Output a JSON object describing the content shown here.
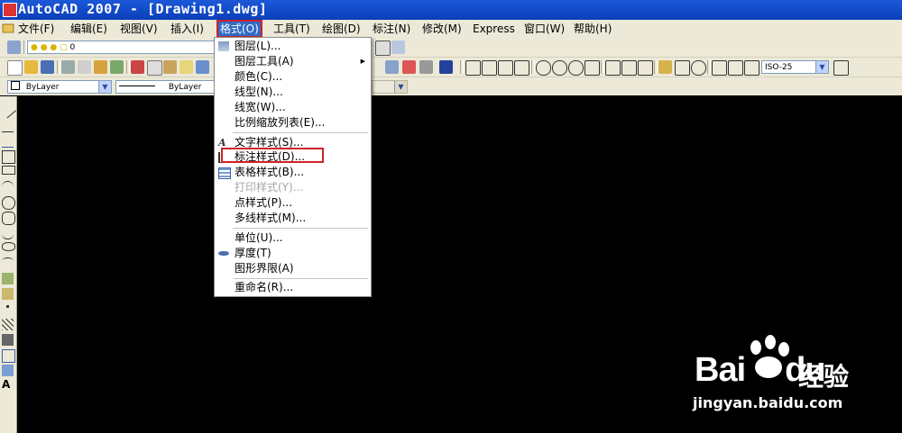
{
  "window": {
    "title": "AutoCAD 2007 - [Drawing1.dwg]"
  },
  "menubar": {
    "items": [
      "文件(F)",
      "编辑(E)",
      "视图(V)",
      "插入(I)",
      "格式(O)",
      "工具(T)",
      "绘图(D)",
      "标注(N)",
      "修改(M)",
      "Express",
      "窗口(W)",
      "帮助(H)"
    ]
  },
  "toolbar": {
    "layer_value": "0",
    "color_combo": "ByLayer",
    "linetype_combo": "ByLayer",
    "dimstyle_combo": "ISO-25"
  },
  "format_menu": {
    "items": [
      {
        "label": "图层(L)...",
        "icon": "layers-icon"
      },
      {
        "label": "图层工具(A)",
        "submenu": true
      },
      {
        "label": "颜色(C)..."
      },
      {
        "label": "线型(N)..."
      },
      {
        "label": "线宽(W)..."
      },
      {
        "label": "比例缩放列表(E)..."
      },
      {
        "label": "文字样式(S)...",
        "icon": "text-style-icon"
      },
      {
        "label": "标注样式(D)...",
        "icon": "dim-style-icon",
        "highlighted": true
      },
      {
        "label": "表格样式(B)...",
        "icon": "table-style-icon"
      },
      {
        "label": "打印样式(Y)...",
        "disabled": true
      },
      {
        "label": "点样式(P)..."
      },
      {
        "label": "多线样式(M)..."
      },
      {
        "label": "单位(U)..."
      },
      {
        "label": "厚度(T)",
        "icon": "thickness-icon"
      },
      {
        "label": "图形界限(A)"
      },
      {
        "label": "重命名(R)..."
      }
    ]
  },
  "watermark": {
    "brand": "Bai",
    "brand_suffix": "du",
    "cn": "经验",
    "url": "jingyan.baidu.com"
  },
  "colors": {
    "accent": "#316ac5",
    "highlight": "#d0222a",
    "titlebar": "#0a3fb9"
  }
}
